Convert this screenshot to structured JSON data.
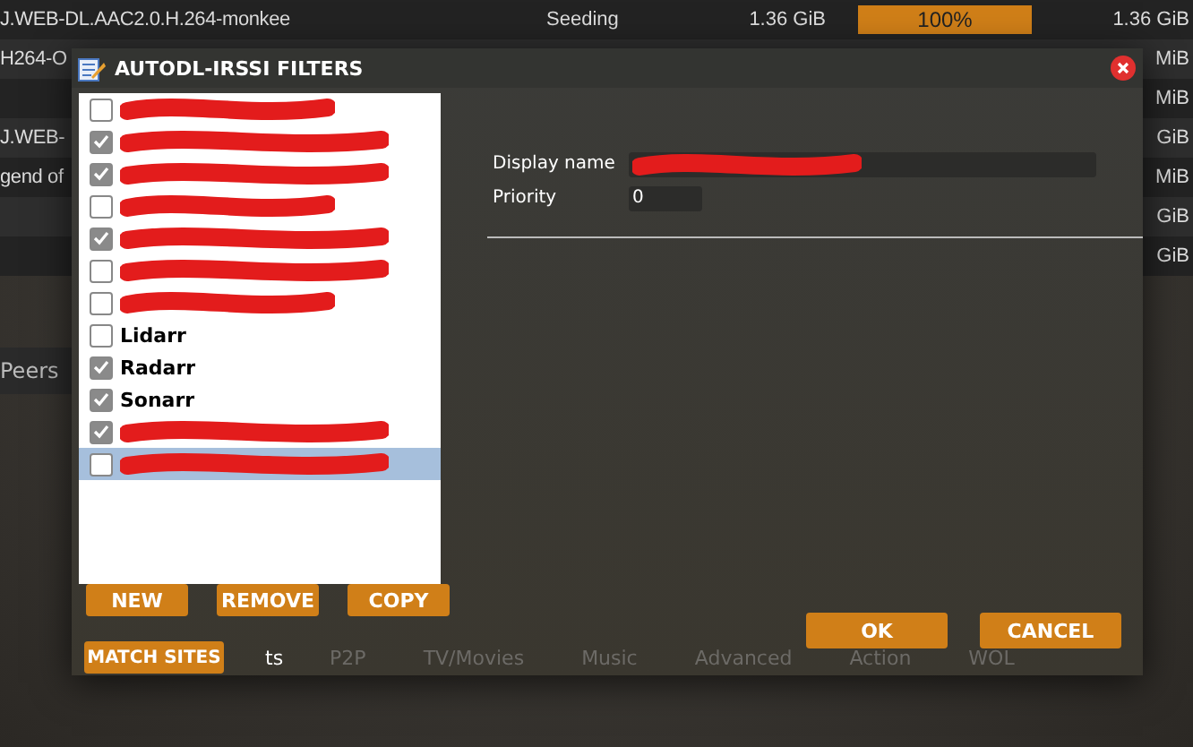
{
  "background": {
    "rows": [
      {
        "name": "J.WEB-DL.AAC2.0.H.264-monkee",
        "status": "Seeding",
        "size": "1.36 GiB",
        "progress": {
          "level": 1,
          "text": "100%"
        },
        "done": "1.36 GiB"
      },
      {
        "name": "H264-O",
        "done": "MiB"
      },
      {
        "done": "MiB"
      },
      {
        "name": "J.WEB-",
        "done": "GiB"
      },
      {
        "name": "gend of",
        "done": "MiB"
      },
      {
        "done": "GiB"
      },
      {
        "done": "GiB"
      }
    ],
    "side_label": "Peers"
  },
  "dialog": {
    "title": "AUTODL-IRSSI FILTERS",
    "filters": [
      {
        "kind": "redacted",
        "checked": false,
        "selected": false
      },
      {
        "kind": "redacted",
        "checked": true,
        "selected": false
      },
      {
        "kind": "redacted",
        "checked": true,
        "selected": false
      },
      {
        "kind": "redacted",
        "checked": false,
        "selected": false
      },
      {
        "kind": "redacted",
        "checked": true,
        "selected": false
      },
      {
        "kind": "redacted",
        "checked": false,
        "selected": false
      },
      {
        "kind": "redacted",
        "checked": false,
        "selected": false
      },
      {
        "kind": "text",
        "label": "Lidarr",
        "checked": false,
        "selected": false
      },
      {
        "kind": "text",
        "label": "Radarr",
        "checked": true,
        "selected": false
      },
      {
        "kind": "text",
        "label": "Sonarr",
        "checked": true,
        "selected": false
      },
      {
        "kind": "redacted",
        "checked": true,
        "selected": false
      },
      {
        "kind": "redacted",
        "checked": false,
        "selected": true
      }
    ],
    "list_buttons": [
      "NEW",
      "REMOVE",
      "COPY"
    ],
    "fields": [
      {
        "label": "Display name",
        "kind": "redacted"
      },
      {
        "label": "Priority",
        "kind": "text",
        "value": "0"
      }
    ],
    "tabs": {
      "button": "MATCH SITES",
      "partial": "ts",
      "labels": [
        "P2P",
        "TV/Movies",
        "Music",
        "Advanced",
        "Action",
        "WOL"
      ]
    },
    "buttons": [
      "OK",
      "CANCEL"
    ]
  }
}
